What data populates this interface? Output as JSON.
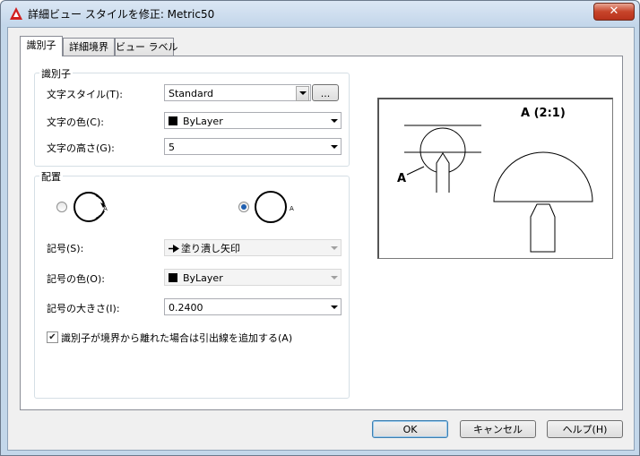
{
  "window": {
    "title": "詳細ビュー スタイルを修正: Metric50",
    "close_glyph": "✕",
    "app_icon": "autocad-logo-icon"
  },
  "tabs": [
    {
      "label": "識別子",
      "active": true
    },
    {
      "label": "詳細境界",
      "active": false
    },
    {
      "label": "ビュー ラベル",
      "active": false
    }
  ],
  "identifier_group": {
    "label": "識別子",
    "text_style_label": "文字スタイル(T):",
    "text_style_value": "Standard",
    "browse_label": "...",
    "text_color_label": "文字の色(C):",
    "text_color_value": "ByLayer",
    "text_height_label": "文字の高さ(G):",
    "text_height_value": "5"
  },
  "placement_group": {
    "label": "配置",
    "option1_glyph": "A",
    "option2_glyph": "A",
    "option1_selected": false,
    "option2_selected": true,
    "symbol_label": "記号(S):",
    "symbol_value": "塗り潰し矢印",
    "symbol_color_label": "記号の色(O):",
    "symbol_color_value": "ByLayer",
    "symbol_size_label": "記号の大きさ(I):",
    "symbol_size_value": "0.2400",
    "leader_checkbox_label": "識別子が境界から離れた場合は引出線を追加する(A)",
    "leader_checkbox_checked": true
  },
  "preview": {
    "view_label": "A (2:1)",
    "identifier_label": "A"
  },
  "buttons": {
    "ok": "OK",
    "cancel": "キャンセル",
    "help": "ヘルプ(H)"
  },
  "colors": {
    "title_bar": "#c3d6ea",
    "close_red": "#c7442a",
    "radio_selected": "#1e5fb0"
  }
}
